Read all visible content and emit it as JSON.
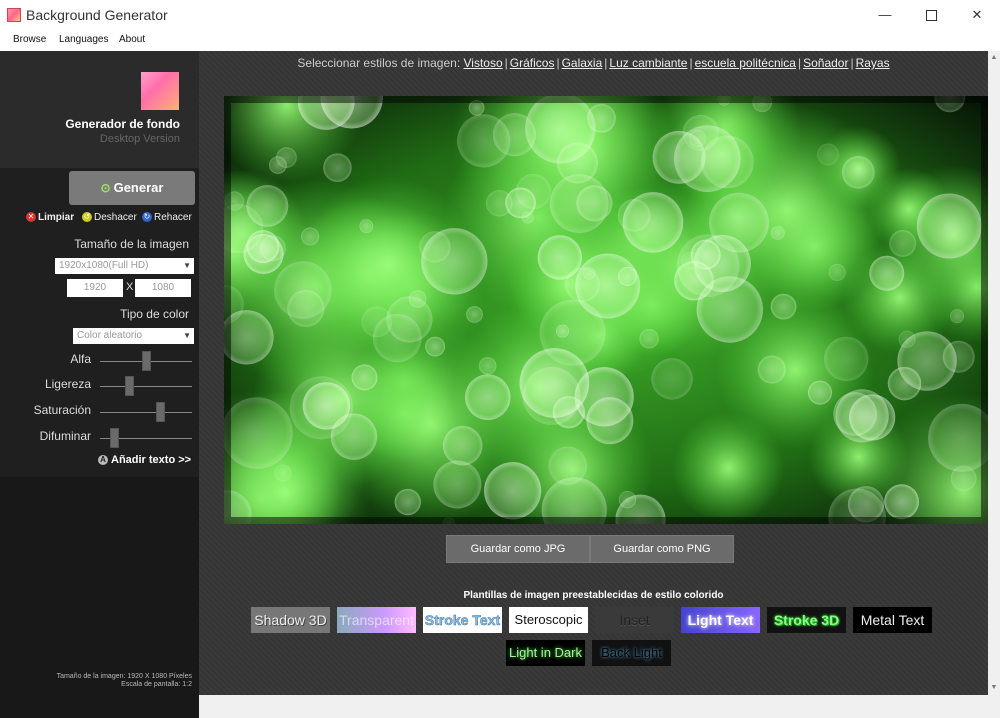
{
  "window": {
    "title": "Background Generator",
    "minimize": "—",
    "close": "✕"
  },
  "menu": [
    "Browse",
    "Languages",
    "About"
  ],
  "sidebar": {
    "app_name": "Generador de fondo",
    "app_sub": "Desktop Version",
    "generate_label": "Generar",
    "clear_label": "Limpiar",
    "undo_label": "Deshacer",
    "redo_label": "Rehacer",
    "size_title": "Tamaño de la imagen",
    "size_select": "1920x1080(Full HD)",
    "width_value": "1920",
    "x_label": "X",
    "height_value": "1080",
    "color_type_title": "Tipo de color",
    "color_select": "Color aleatorio",
    "sliders": [
      {
        "label": "Alfa",
        "value": 0.5
      },
      {
        "label": "Ligereza",
        "value": 0.3
      },
      {
        "label": "Saturación",
        "value": 0.67
      },
      {
        "label": "Difuminar",
        "value": 0.12
      }
    ],
    "add_text_label": "Añadir texto >>",
    "footer_line1": "Tamaño de la imagen: 1920 X 1080 Píxeles",
    "footer_line2": "Escala de pantalla: 1:2"
  },
  "main": {
    "styles_prefix": "Seleccionar estilos de imagen:",
    "styles": [
      "Vistoso",
      "Gráficos",
      "Galaxia",
      "Luz cambiante",
      "escuela politécnica",
      "Soñador",
      "Rayas"
    ],
    "save_jpg": "Guardar como JPG",
    "save_png": "Guardar como PNG",
    "templates_title": "Plantillas de imagen preestablecidas de estilo colorido",
    "templates": [
      "Shadow 3D",
      "Transparent",
      "Stroke Text",
      "Steroscopic",
      "Inset",
      "Light Text",
      "Stroke 3D",
      "Metal Text",
      "Light in Dark",
      "Back Light"
    ]
  },
  "colors": {
    "sidebar_bg": "#1f1f1f",
    "main_bg": "#3a3a3a",
    "accent_green": "#6ee05a"
  }
}
